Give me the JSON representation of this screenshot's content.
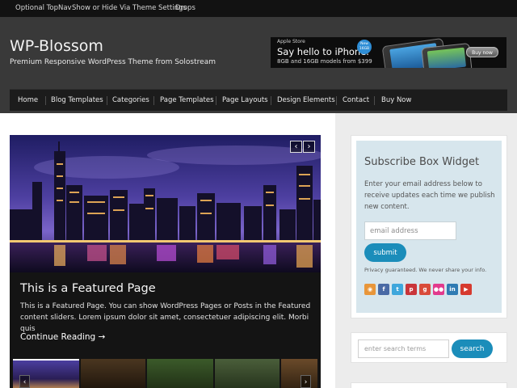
{
  "topnav": {
    "items": [
      "Optional TopNav",
      "Show or Hide Via Theme Settings",
      "Drops"
    ]
  },
  "header": {
    "title": "WP-Blossom",
    "description": "Premium Responsive WordPress Theme from Solostream"
  },
  "ad": {
    "store": "Apple Store",
    "headline": "Say hello to iPhone.",
    "subline": "8GB and 16GB models from $399",
    "badge": "New 16GB",
    "button": "Buy now"
  },
  "mainnav": {
    "items": [
      "Home",
      "Blog Templates",
      "Categories",
      "Page Templates",
      "Page Layouts",
      "Design Elements",
      "Contact",
      "Buy Now"
    ]
  },
  "slider": {
    "title": "This is a Featured Page",
    "text": "This is a Featured Page. You can show WordPress Pages or Posts in the Featured content sliders. Lorem ipsum dolor sit amet, consectetuer adipiscing elit. Morbi quis",
    "more": "Continue Reading →",
    "prev_icon": "chevron-left-icon",
    "next_icon": "chevron-right-icon"
  },
  "subscribe": {
    "title": "Subscribe Box Widget",
    "text": "Enter your email address below to receive updates each time we publish new content.",
    "placeholder": "email address",
    "button": "submit",
    "privacy": "Privacy guaranteed. We never share your info."
  },
  "social": [
    {
      "name": "rss-icon",
      "glyph": "◉",
      "color": "#e8963a"
    },
    {
      "name": "facebook-icon",
      "glyph": "f",
      "color": "#4a6aa5"
    },
    {
      "name": "twitter-icon",
      "glyph": "t",
      "color": "#3fa7dc"
    },
    {
      "name": "pinterest-icon",
      "glyph": "p",
      "color": "#c9353a"
    },
    {
      "name": "google-plus-icon",
      "glyph": "g",
      "color": "#d94b3a"
    },
    {
      "name": "flickr-icon",
      "glyph": "●●",
      "color": "#e23a8d"
    },
    {
      "name": "linkedin-icon",
      "glyph": "in",
      "color": "#2f7bb3"
    },
    {
      "name": "youtube-icon",
      "glyph": "▶",
      "color": "#d63a2f"
    }
  ],
  "search": {
    "placeholder": "enter search terms",
    "button": "search"
  }
}
